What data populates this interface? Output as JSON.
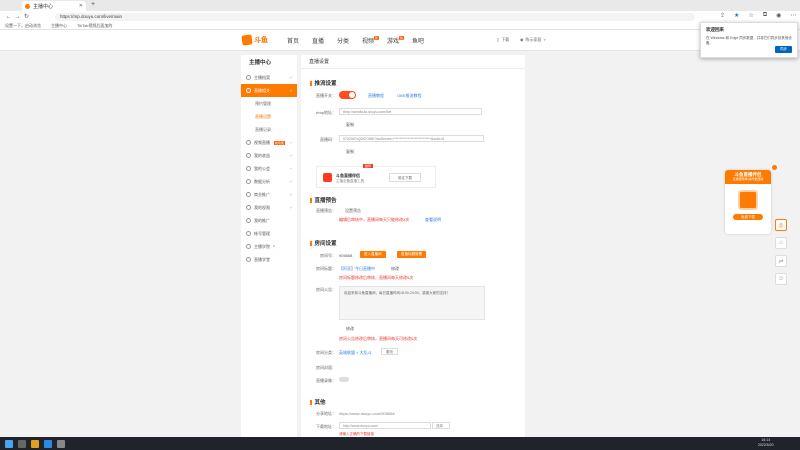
{
  "browser": {
    "tab_title": "主播中心",
    "new_tab": "+",
    "url": "https://mp.douyu.com/live/main",
    "bookmarks": [
      "设置一下，启动浏览",
      "主播中心",
      "TikTok视频后面加的"
    ]
  },
  "site": {
    "logo_text": "斗鱼",
    "nav": [
      {
        "label": "首页"
      },
      {
        "label": "直播"
      },
      {
        "label": "分类"
      },
      {
        "label": "视频",
        "badge": "新"
      },
      {
        "label": "游戏",
        "badge": "热"
      },
      {
        "label": "鱼吧"
      }
    ],
    "download": "下载",
    "user": "陈示家庭"
  },
  "sidebar": {
    "title": "主播中心",
    "items": [
      {
        "label": "主播档案"
      },
      {
        "label": "直播相关",
        "active": true
      },
      {
        "label": "预约管理",
        "sub": true
      },
      {
        "label": "直播设置",
        "sub": true,
        "selected": true
      },
      {
        "label": "直播记录",
        "sub": true
      },
      {
        "label": "视频直播",
        "badge": "新功能"
      },
      {
        "label": "我的收益"
      },
      {
        "label": "我的公会"
      },
      {
        "label": "数据分析"
      },
      {
        "label": "商业推广"
      },
      {
        "label": "我的权限"
      },
      {
        "label": "我的推广"
      },
      {
        "label": "帐号管理"
      },
      {
        "label": "主播学院"
      },
      {
        "label": "直播学堂"
      }
    ]
  },
  "main": {
    "breadcrumb": "直播设置",
    "push": {
      "section": "推流设置",
      "label_switch": "直播开关：",
      "link_tutorial": "直播教程",
      "link_obs": "OBS推流教程",
      "label_rtmp": "rtmp地址：",
      "rtmp_value": "rtmp://sendtc3a.douyu.com/live",
      "copy1": "复制",
      "label_code": "直播码：",
      "code_value": "9702467rQDfZOWK?wsSecret=****************************&auth=5",
      "copy2": "复制",
      "helper_title": "斗鱼直播伴侣",
      "helper_sub": "主播必备直播工具",
      "helper_tag": "推荐",
      "helper_btn": "前往下载"
    },
    "preview": {
      "section": "直播预告",
      "label": "直播预告：",
      "placeholder": "设置预告",
      "warn": "编辑后审核中，直播间每天只能修改3次",
      "link": "查看说明"
    },
    "room": {
      "section": "房间设置",
      "label_id": "房间号：",
      "id_value": "905668",
      "btn_enter": "进入直播间",
      "btn_title": "直播标题管理",
      "label_name": "房间标题：",
      "name_value": "【阿亚】今日直播中",
      "edit1": "修改",
      "warn1": "房间标题修改后审核，直播间每天修改5次",
      "label_notice": "房间公告：",
      "notice_value": "欢迎来到斗鱼直播间，每日直播时间18:00-24:00，感谢大家的支持！",
      "edit2": "修改",
      "warn2": "房间公告修改后审核，直播间每天可修改5次",
      "label_cat": "房间分类：",
      "cat_value": "英雄联盟 > 大乱斗",
      "change": "更改",
      "label_cover": "房间封面：",
      "label_record": "直播录像："
    },
    "other": {
      "section": "其他",
      "label_share": "分享地址：",
      "share_value": "https://www.douyu.com/905668",
      "label_dl": "下载地址：",
      "dl_value": "http://www.douyu.com/",
      "dl_select": "选择",
      "dl_warn": "请输入正确的下载链接"
    }
  },
  "popup": {
    "title": "欢迎回来",
    "body": "在 Windows 和 Edge 同步数据，并将它们同步到其他设备。",
    "button": "同步"
  },
  "promo": {
    "title": "斗鱼直播伴侣",
    "sub": "直播更简单 操作更便捷",
    "button": "免费下载"
  },
  "taskbar": {
    "time": "16:14",
    "date": "2022/5/20"
  }
}
